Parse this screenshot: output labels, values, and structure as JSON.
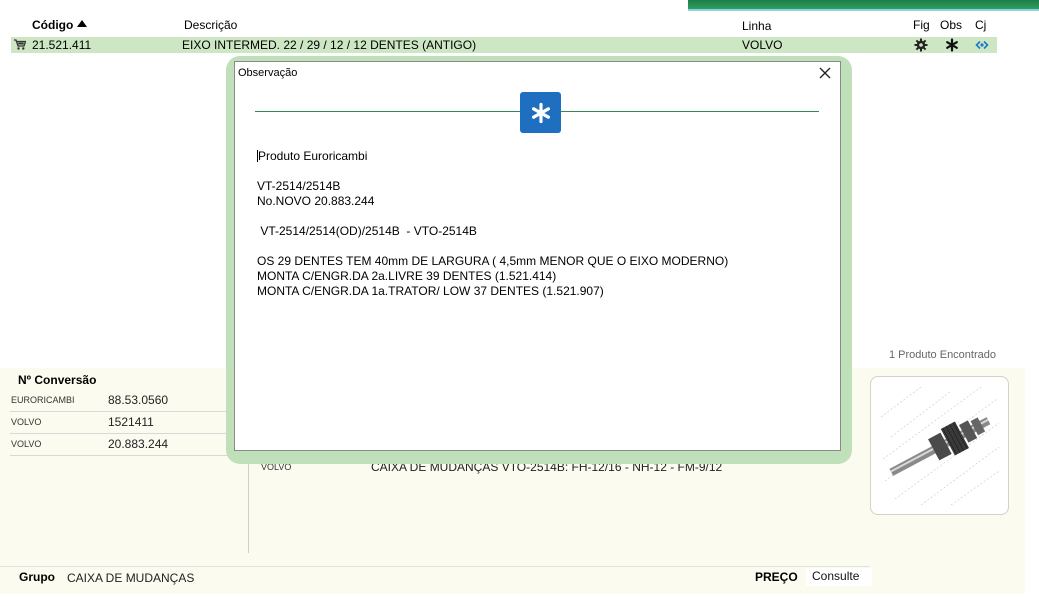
{
  "table": {
    "headers": {
      "codigo": "Código",
      "descricao": "Descrição",
      "linha": "Linha",
      "fig": "Fig",
      "obs": "Obs",
      "cj": "Cj"
    },
    "row": {
      "codigo": "21.521.411",
      "descricao": "EIXO INTERMED. 22 / 29 / 12 / 12 DENTES (ANTIGO)",
      "linha": "VOLVO"
    }
  },
  "results": {
    "found_text": "1 Produto Encontrado"
  },
  "conversion": {
    "title": "Nº Conversão",
    "rows": [
      {
        "brand": "EURORICAMBI",
        "code": "88.53.0560"
      },
      {
        "brand": "VOLVO",
        "code": "1521411"
      },
      {
        "brand": "VOLVO",
        "code": "20.883.244"
      }
    ]
  },
  "application": {
    "linha": "VOLVO",
    "descricao": "CAIXA DE MUDANÇAS VTO-2514B: FH-12/16 - NH-12 - FM-9/12"
  },
  "footer": {
    "grupo_label": "Grupo",
    "grupo_value": "CAIXA DE MUDANÇAS",
    "preco_label": "PREÇO",
    "preco_value": "Consulte"
  },
  "modal": {
    "title": "Observação",
    "lines": [
      "Produto Euroricambi",
      "",
      "VT-2514/2514B",
      "No.NOVO 20.883.244",
      "",
      " VT-2514/2514(OD)/2514B  - VTO-2514B",
      "",
      "OS 29 DENTES TEM 40mm DE LARGURA ( 4,5mm MENOR QUE O EIXO MODERNO)",
      "MONTA C/ENGR.DA 2a.LIVRE 39 DENTES (1.521.414)",
      "MONTA C/ENGR.DA 1a.TRATOR/ LOW 37 DENTES (1.521.907)"
    ]
  },
  "icons": {
    "cart": "cart-icon",
    "figure": "gear-icon",
    "observation": "asterisk-icon",
    "set": "link-icon",
    "close": "close-icon",
    "badge": "asterisk-icon"
  },
  "colors": {
    "row_highlight": "#cde6c4",
    "badge_blue": "#1f6fc0",
    "divider_green": "#2e8b57",
    "panel_bg": "#fbfbf0"
  }
}
